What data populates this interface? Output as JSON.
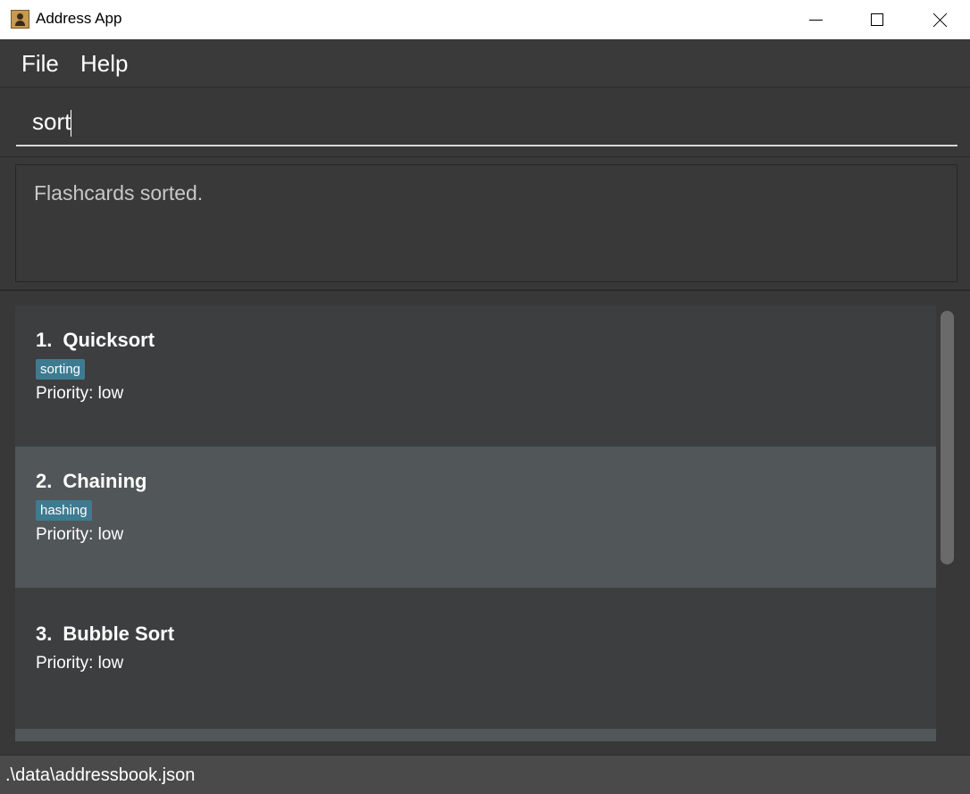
{
  "window": {
    "title": "Address App"
  },
  "menu": {
    "items": [
      "File",
      "Help"
    ]
  },
  "command": {
    "value": "sort"
  },
  "result": {
    "message": "Flashcards sorted."
  },
  "cards": [
    {
      "index": "1.",
      "title": "Quicksort",
      "tag": "sorting",
      "priority": "Priority: low"
    },
    {
      "index": "2.",
      "title": "Chaining",
      "tag": "hashing",
      "priority": "Priority: low"
    },
    {
      "index": "3.",
      "title": "Bubble Sort",
      "tag": "",
      "priority": "Priority: low"
    }
  ],
  "status": {
    "path": ".\\data\\addressbook.json"
  },
  "colors": {
    "tag_bg": "#3e7b91",
    "card_odd": "#3c3e3f",
    "card_even": "#515658",
    "background": "#383838"
  }
}
